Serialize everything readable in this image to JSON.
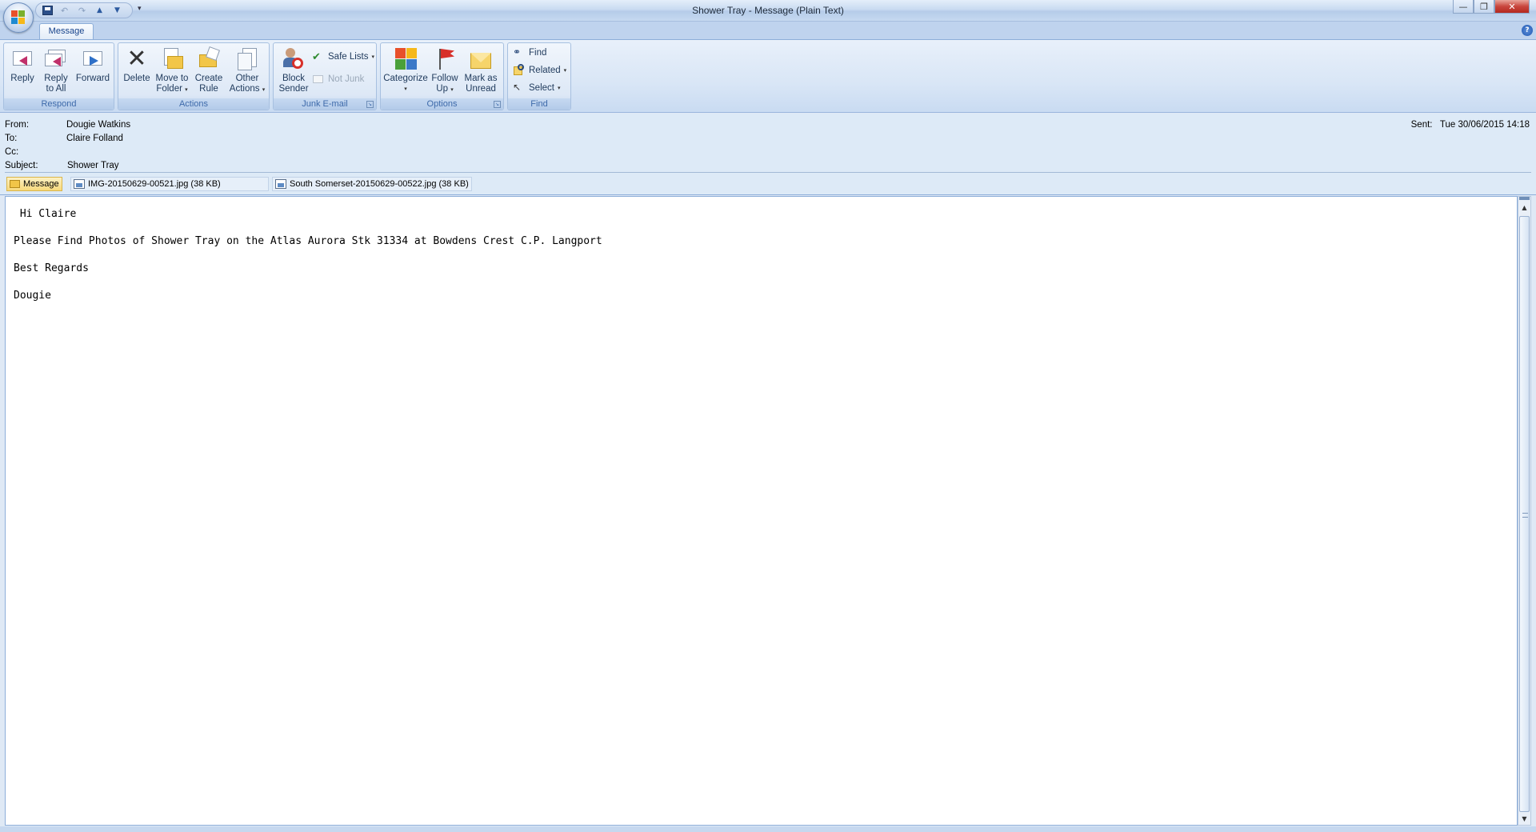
{
  "window": {
    "title": "Shower Tray - Message (Plain Text)",
    "minimize": "—",
    "maximize": "❐",
    "close": "✕"
  },
  "qat": {
    "save": "💾",
    "undo": "↶",
    "redo": "↷",
    "prev": "▲",
    "next": "▼",
    "customize": "▾"
  },
  "tabs": [
    {
      "label": "Message",
      "selected": true
    }
  ],
  "help": "?",
  "ribbon": {
    "respond": {
      "label": "Respond",
      "reply": "Reply",
      "reply_all_1": "Reply",
      "reply_all_2": "to All",
      "forward": "Forward"
    },
    "actions": {
      "label": "Actions",
      "delete": "Delete",
      "move_1": "Move to",
      "move_2": "Folder",
      "create_1": "Create",
      "create_2": "Rule",
      "other_1": "Other",
      "other_2": "Actions"
    },
    "junk": {
      "label": "Junk E-mail",
      "block_1": "Block",
      "block_2": "Sender",
      "safe_lists": "Safe Lists",
      "not_junk": "Not Junk"
    },
    "options": {
      "label": "Options",
      "categorize": "Categorize",
      "follow_1": "Follow",
      "follow_2": "Up",
      "mark_1": "Mark as",
      "mark_2": "Unread"
    },
    "find": {
      "label": "Find",
      "find": "Find",
      "related": "Related",
      "select": "Select"
    }
  },
  "header": {
    "from_label": "From:",
    "from": "Dougie Watkins",
    "to_label": "To:",
    "to": "Claire Folland",
    "cc_label": "Cc:",
    "cc": "",
    "subject_label": "Subject:",
    "subject": "Shower Tray",
    "sent_label": "Sent:",
    "sent": "Tue 30/06/2015 14:18"
  },
  "attachments": {
    "message_tab": "Message",
    "files": [
      "IMG-20150629-00521.jpg (38 KB)",
      "South Somerset-20150629-00522.jpg (38 KB)"
    ]
  },
  "body": {
    "lines": [
      " Hi Claire",
      "Please Find Photos of Shower Tray on the Atlas Aurora Stk 31334 at Bowdens Crest C.P. Langport",
      "Best Regards",
      "Dougie"
    ]
  },
  "colors": {
    "accent": "#15428b",
    "ribbon_bg": "#dfe9f5",
    "close_red": "#c9463d"
  }
}
